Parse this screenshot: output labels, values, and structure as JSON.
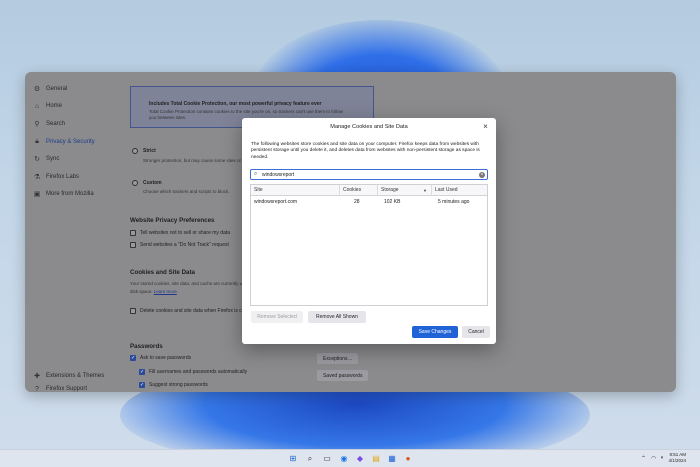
{
  "settings": {
    "nav": [
      {
        "label": "General",
        "icon": "gear-icon"
      },
      {
        "label": "Home",
        "icon": "home-icon"
      },
      {
        "label": "Search",
        "icon": "search-icon"
      },
      {
        "label": "Privacy & Security",
        "icon": "lock-icon"
      },
      {
        "label": "Sync",
        "icon": "sync-icon"
      },
      {
        "label": "Firefox Labs",
        "icon": "flask-icon"
      },
      {
        "label": "More from Mozilla",
        "icon": "mozilla-icon"
      }
    ],
    "bottom_nav": [
      {
        "label": "Extensions & Themes",
        "icon": "puzzle-icon"
      },
      {
        "label": "Firefox Support",
        "icon": "help-icon"
      }
    ],
    "tcp_box": {
      "title": "Includes Total Cookie Protection, our most powerful privacy feature ever",
      "text": "Total Cookie Protection contains cookies to the site you're on, so trackers can't use them to follow you between sites."
    },
    "strict": {
      "label": "Strict",
      "desc": "Stronger protection, but may cause some sites or content to break."
    },
    "custom": {
      "label": "Custom",
      "desc": "Choose which trackers and scripts to block."
    },
    "privacy_prefs": {
      "heading": "Website Privacy Preferences",
      "opt1": "Tell websites not to sell or share my data",
      "opt2": "Send websites a \"Do Not Track\" request"
    },
    "cookies": {
      "heading": "Cookies and Site Data",
      "desc": "Your stored cookies, site data, and cache are currently using",
      "desc2": "disk space.",
      "learn_more": "Learn more",
      "delete_opt": "Delete cookies and site data when Firefox is closed"
    },
    "passwords": {
      "heading": "Passwords",
      "ask": "Ask to save passwords",
      "autofill": "Fill usernames and passwords automatically",
      "suggest": "Suggest strong passwords",
      "exceptions_btn": "Exceptions…",
      "saved_btn": "Saved passwords"
    }
  },
  "dialog": {
    "title": "Manage Cookies and Site Data",
    "description": "The following websites store cookies and site data on your computer. Firefox keeps data from websites with persistent storage until you delete it, and deletes data from websites with non-persistent storage as space is needed.",
    "search_value": "windowsreport",
    "columns": [
      "Site",
      "Cookies",
      "Storage",
      "Last Used"
    ],
    "rows": [
      {
        "site": "windowsreport.com",
        "cookies": "28",
        "storage": "102 KB",
        "last_used": "5 minutes ago"
      }
    ],
    "remove_selected": "Remove Selected",
    "remove_all": "Remove All Shown",
    "save": "Save Changes",
    "cancel": "Cancel"
  },
  "taskbar": {
    "time": "8:51 AM",
    "date": "4/1/2024"
  },
  "colors": {
    "accent": "#1f63d6",
    "dimmed_window": "#8b8b8d"
  }
}
